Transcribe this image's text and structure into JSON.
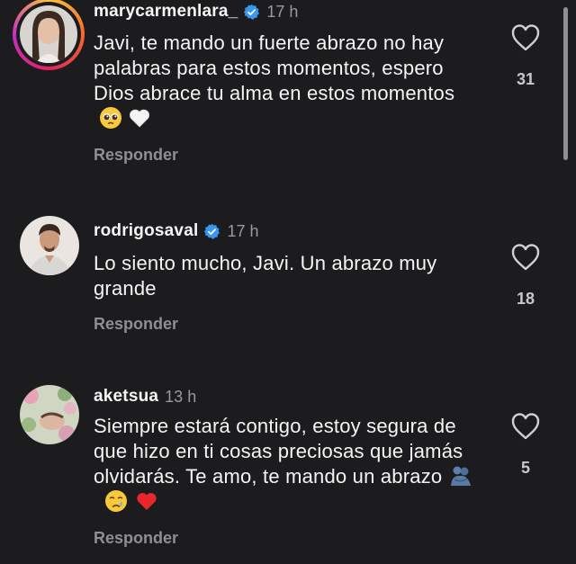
{
  "comments": [
    {
      "username": "marycarmenlara_",
      "verified": true,
      "time": "17 h",
      "text": "Javi, te mando un fuerte abrazo no hay palabras para estos momentos, espero Dios abrace tu alma en estos momentos",
      "emojis": [
        "pleading-face-emoji",
        "white-heart-emoji"
      ],
      "reply_label": "Responder",
      "likes": "31",
      "has_story": true
    },
    {
      "username": "rodrigosaval",
      "verified": true,
      "time": "17 h",
      "text": "Lo siento mucho, Javi. Un abrazo muy grande",
      "emojis": [],
      "reply_label": "Responder",
      "likes": "18",
      "has_story": false
    },
    {
      "username": "aketsua",
      "verified": false,
      "time": "13 h",
      "text": "Siempre estará contigo, estoy segura de que hizo en ti cosas preciosas que jamás olvidarás. Te amo, te mando un abrazo",
      "emojis": [
        "people-hugging-emoji",
        "crying-face-emoji",
        "red-heart-emoji"
      ],
      "reply_label": "Responder",
      "likes": "5",
      "has_story": false
    }
  ],
  "colors": {
    "background": "#1c1c1e",
    "verified_badge": "#3897f0",
    "secondary_text": "#8e8e93"
  }
}
